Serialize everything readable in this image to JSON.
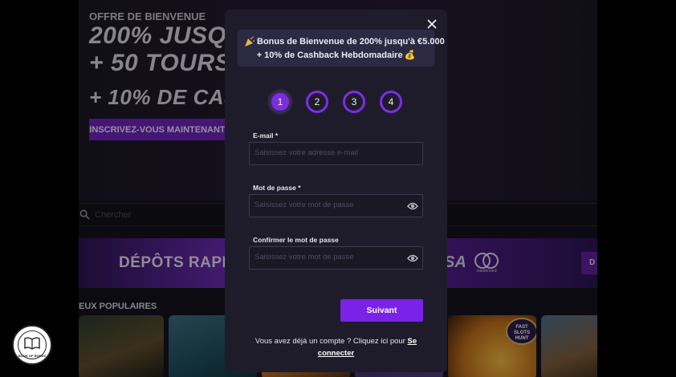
{
  "background": {
    "hero": {
      "kicker": "OFFRE DE BIENVENUE",
      "line1": "200% JUSQU",
      "line2": "+ 50 TOURS G",
      "line3": "+ 10% DE CASHB",
      "cta": "INSCRIVEZ-VOUS MAINTENANT"
    },
    "search": {
      "placeholder": "Chercher"
    },
    "banner": {
      "text": "DÉPÔTS RAPIDE",
      "visa_fragment": "SA",
      "mastercard_caption": "mastercard",
      "button_fragment": "D"
    },
    "section_title": "EUX POPULAIRES",
    "tile_badge": "FAST SLOTS\nHUNT"
  },
  "modal": {
    "promo": {
      "icon": "party-popper-icon",
      "line1": "Bonus de Bienvenue de 200% jusqu'à €5.000",
      "line2": "+ 10% de Cashback Hebdomadaire",
      "icon2": "money-bag-icon"
    },
    "steps": [
      "1",
      "2",
      "3",
      "4"
    ],
    "active_step": 1,
    "fields": {
      "email": {
        "label": "E-mail *",
        "placeholder": "Saisissez votre adresse e-mail",
        "value": ""
      },
      "password": {
        "label": "Mot de passe *",
        "placeholder": "Saisissez votre mot de passe",
        "value": ""
      },
      "confirm": {
        "label": "Confirmer le mot de passe",
        "placeholder": "Saisissez votre mot de passe",
        "value": ""
      }
    },
    "submit_label": "Suivant",
    "login_prompt": "Vous avez déjà un compte ? Cliquez ici pour",
    "login_link": "Se connecter"
  },
  "logo": {
    "text": "BOOK OF BONUS"
  },
  "colors": {
    "accent": "#7b22e8",
    "modal_bg": "#1e1c2b",
    "promo_bg": "#2c2a42"
  }
}
